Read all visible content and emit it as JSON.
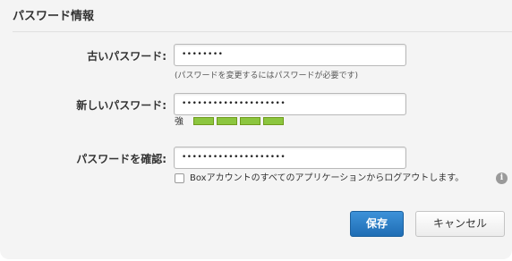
{
  "section": {
    "title": "パスワード情報"
  },
  "current_password": {
    "label": "古いパスワード:",
    "value": "••••••••",
    "hint": "(パスワードを変更するにはパスワードが必要です)"
  },
  "new_password": {
    "label": "新しいパスワード:",
    "value": "••••••••••••••••••••",
    "strength_label": "強",
    "strength_level": 1.0,
    "strength_segments": 4,
    "strength_color": "#8cc63f"
  },
  "confirm_password": {
    "label": "パスワードを確認:",
    "value": "••••••••••••••••••••"
  },
  "logout_option": {
    "label": "Boxアカウントのすべてのアプリケーションからログアウトします。",
    "checked": false,
    "info_icon": "info-icon",
    "info_glyph": "i"
  },
  "actions": {
    "save_label": "保存",
    "cancel_label": "キャンセル",
    "primary_color": "#2a7dc6"
  }
}
